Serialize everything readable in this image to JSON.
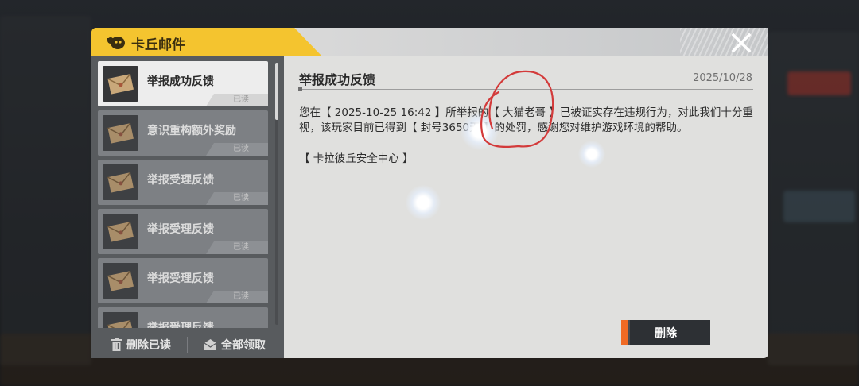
{
  "window": {
    "title": "卡丘邮件",
    "icon": "mail-mascot-icon",
    "close_icon": "close-icon"
  },
  "mail_list": {
    "items": [
      {
        "label": "举报成功反馈",
        "status": "已读",
        "active": true
      },
      {
        "label": "意识重构额外奖励",
        "status": "已读"
      },
      {
        "label": "举报受理反馈",
        "status": "已读"
      },
      {
        "label": "举报受理反馈",
        "status": "已读"
      },
      {
        "label": "举报受理反馈",
        "status": "已读"
      },
      {
        "label": "举报受理反馈",
        "status": ""
      }
    ],
    "delete_read_label": "删除已读",
    "claim_all_label": "全部领取"
  },
  "mail": {
    "title": "举报成功反馈",
    "date": "2025/10/28",
    "body": "您在【 2025-10-25 16:42 】所举报的【 大猫老哥 】已被证实存在违规行为，对此我们十分重视，该玩家目前已得到【 封号3650天 】的处罚，感谢您对维护游戏环境的帮助。",
    "signature": "【 卡拉彼丘安全中心 】",
    "delete_label": "删除"
  },
  "colors": {
    "accent_yellow": "#f4c42f",
    "delete_accent": "#f06a24",
    "annotation_red": "#d33a3a"
  }
}
